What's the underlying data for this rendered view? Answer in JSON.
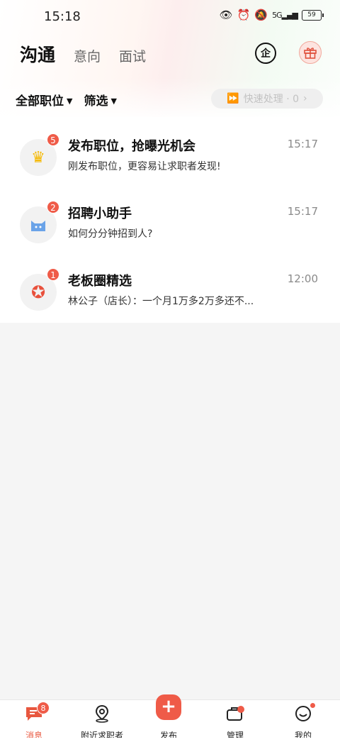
{
  "status_bar": {
    "time": "15:18",
    "battery": "59",
    "network": "5G"
  },
  "header": {
    "tabs": [
      {
        "label": "沟通",
        "active": true
      },
      {
        "label": "意向",
        "active": false
      },
      {
        "label": "面试",
        "active": false
      }
    ],
    "enterprise_icon_text": "企",
    "gift_icon": "gift-icon"
  },
  "filters": {
    "all_positions": "全部职位",
    "filter": "筛选",
    "quick_process": "快速处理 · 0"
  },
  "messages": [
    {
      "title": "发布职位，抢曝光机会",
      "subtitle": "刚发布职位，更容易让求职者发现!",
      "time": "15:17",
      "badge": "5",
      "icon": "crown-icon"
    },
    {
      "title": "招聘小助手",
      "subtitle": "如何分分钟招到人?",
      "time": "15:17",
      "badge": "2",
      "icon": "cat-icon"
    },
    {
      "title": "老板圈精选",
      "subtitle": "林公子（店长）：一个月1万多2万多还不...",
      "time": "12:00",
      "badge": "1",
      "icon": "star-icon"
    }
  ],
  "bottom_nav": [
    {
      "label": "消息",
      "active": true,
      "badge": "8",
      "icon": "chat-icon"
    },
    {
      "label": "附近求职者",
      "active": false,
      "icon": "location-icon"
    },
    {
      "label": "发布",
      "active": false,
      "icon": "plus-icon"
    },
    {
      "label": "管理",
      "active": false,
      "icon": "briefcase-icon"
    },
    {
      "label": "我的",
      "active": false,
      "icon": "smile-icon"
    }
  ],
  "colors": {
    "accent": "#ef5b48",
    "background": "#f5f5f5"
  }
}
